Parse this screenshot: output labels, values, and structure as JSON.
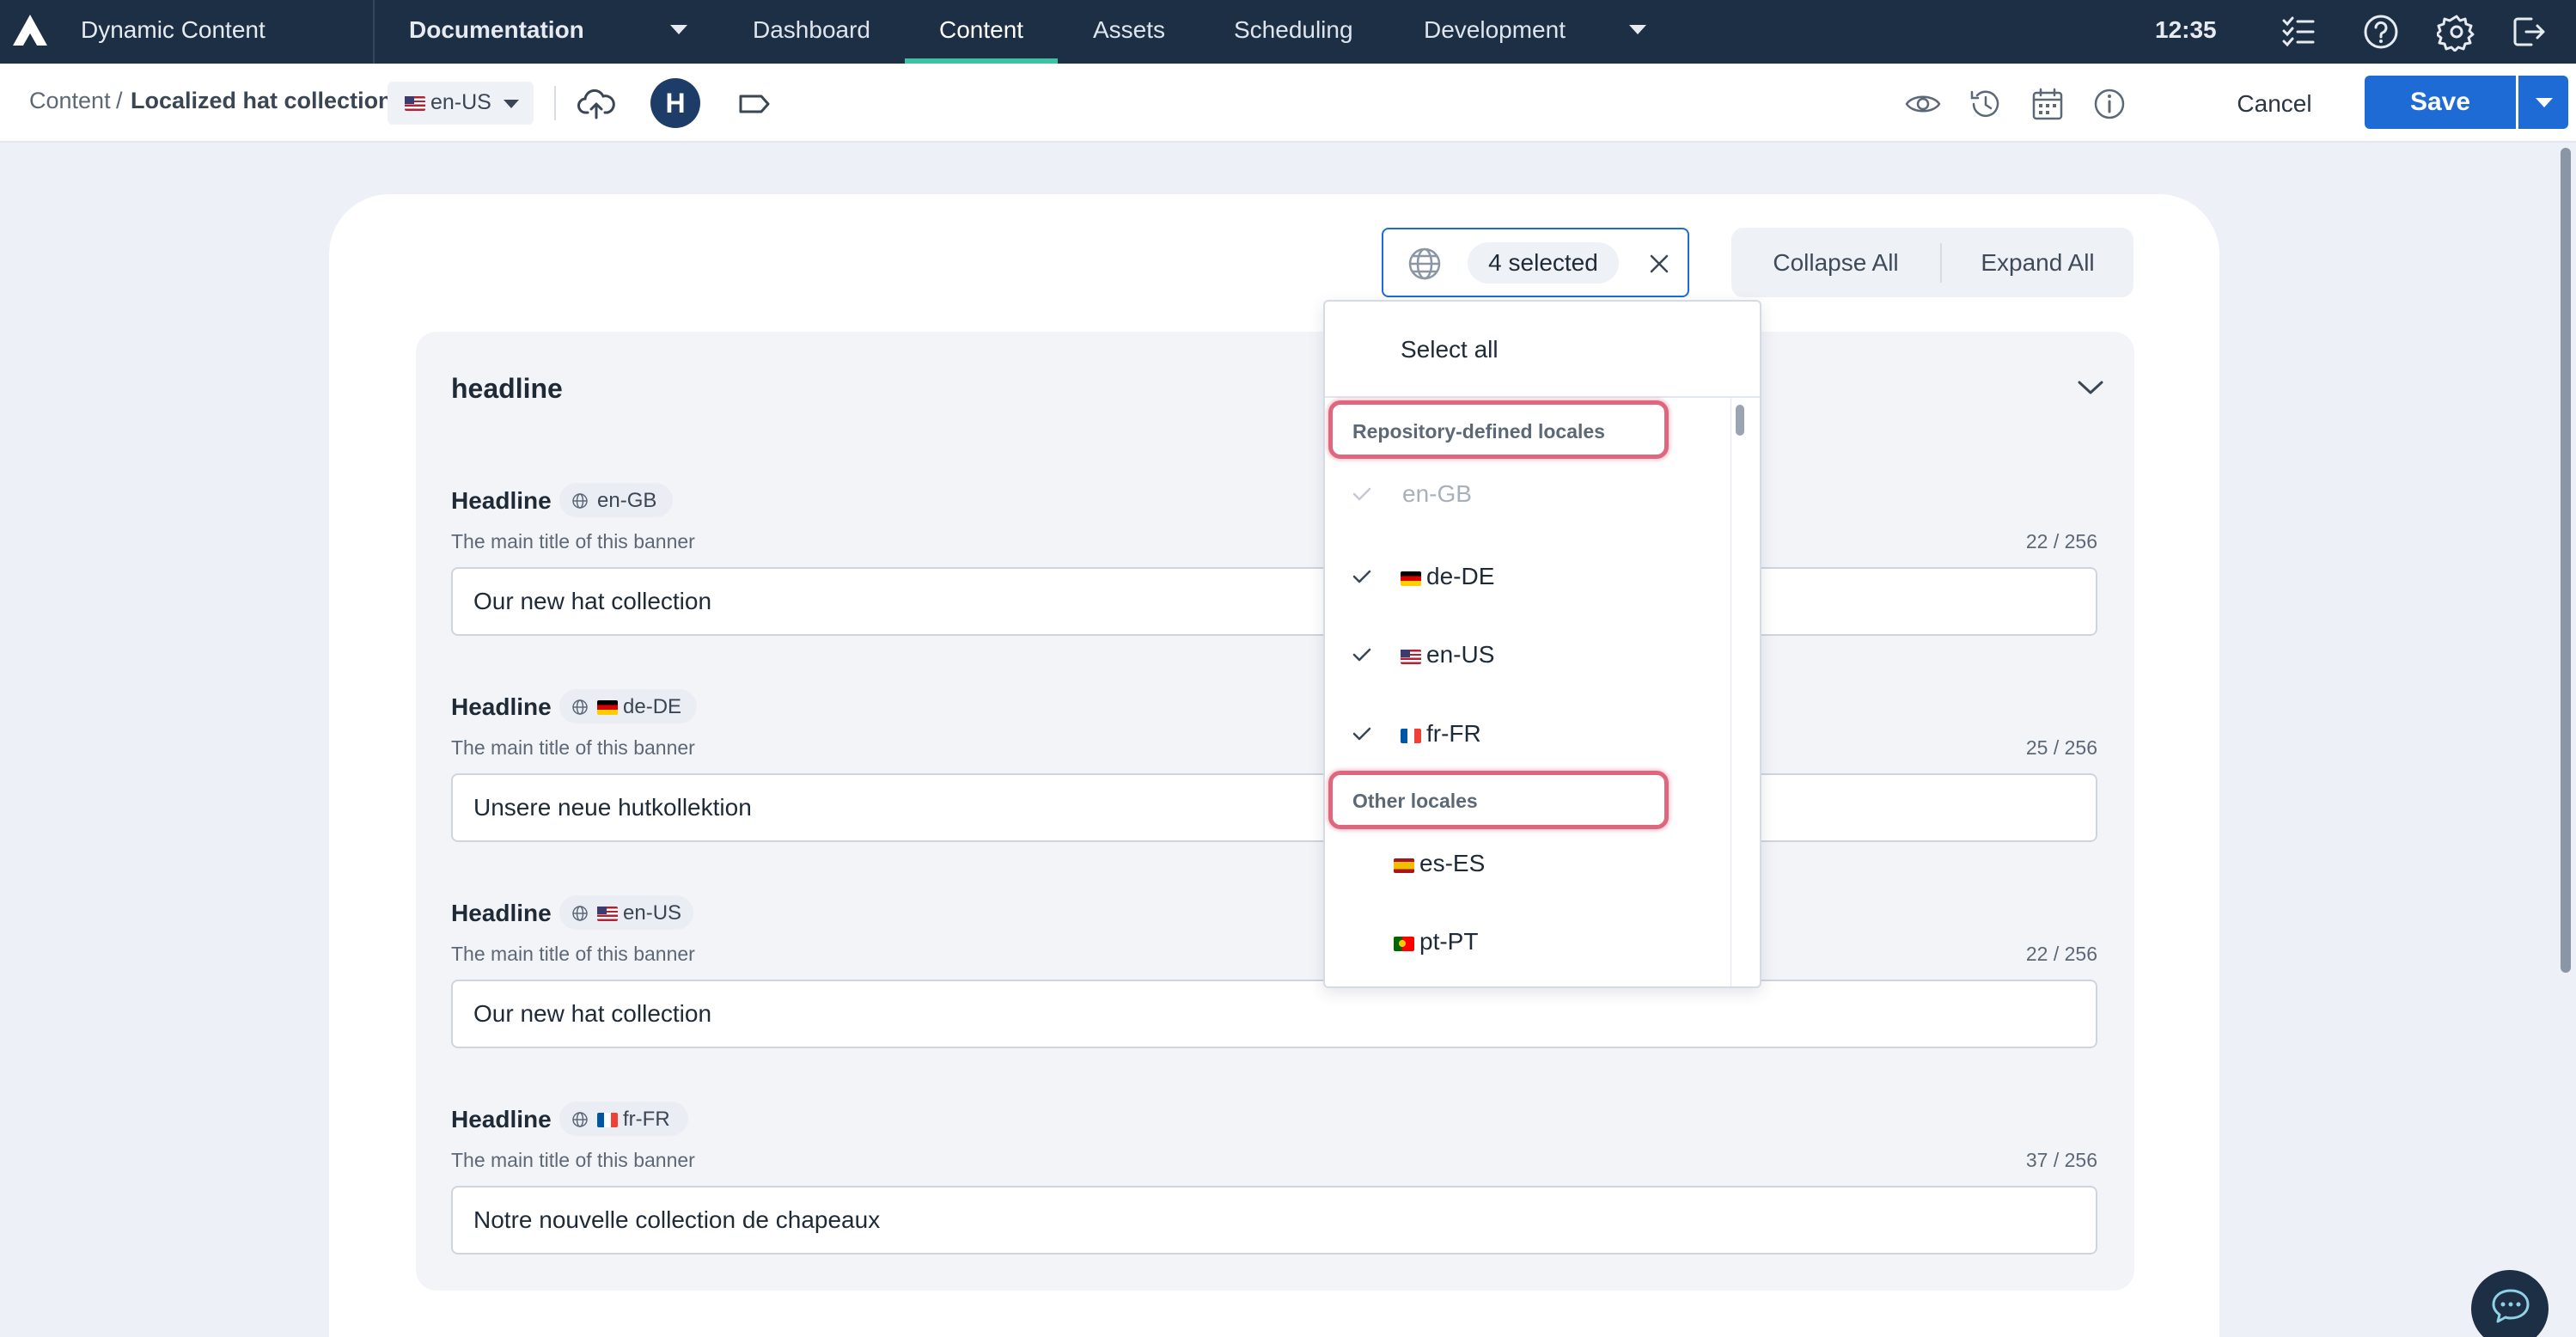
{
  "topbar": {
    "app_name": "Dynamic Content",
    "hub_name": "Documentation",
    "nav": [
      "Dashboard",
      "Content",
      "Assets",
      "Scheduling",
      "Development"
    ],
    "active_nav": "Content",
    "clock": "12:35"
  },
  "subbar": {
    "breadcrumb_root": "Content",
    "breadcrumb_sep": "/",
    "breadcrumb_current": "Localized hat collection",
    "locale": "en-US",
    "avatar_initial": "H",
    "cancel_label": "Cancel",
    "save_label": "Save"
  },
  "toolbar": {
    "filter_count": "4 selected",
    "collapse_all": "Collapse All",
    "expand_all": "Expand All"
  },
  "section": {
    "title": "headline",
    "fields": [
      {
        "label": "Headline",
        "locale": "en-GB",
        "flag": "none",
        "description": "The main title of this banner",
        "count": "22 / 256",
        "value": "Our new hat collection"
      },
      {
        "label": "Headline",
        "locale": "de-DE",
        "flag": "de",
        "description": "The main title of this banner",
        "count": "25 / 256",
        "value": "Unsere neue hutkollektion"
      },
      {
        "label": "Headline",
        "locale": "en-US",
        "flag": "us",
        "description": "The main title of this banner",
        "count": "22 / 256",
        "value": "Our new hat collection"
      },
      {
        "label": "Headline",
        "locale": "fr-FR",
        "flag": "fr",
        "description": "The main title of this banner",
        "count": "37 / 256",
        "value": "Notre nouvelle collection de chapeaux"
      }
    ]
  },
  "dropdown": {
    "select_all": "Select all",
    "group_repository": "Repository-defined locales",
    "group_other": "Other locales",
    "repository_items": [
      {
        "code": "en-GB",
        "flag": "none",
        "checked": true,
        "disabled": true
      },
      {
        "code": "de-DE",
        "flag": "de",
        "checked": true,
        "disabled": false
      },
      {
        "code": "en-US",
        "flag": "us",
        "checked": true,
        "disabled": false
      },
      {
        "code": "fr-FR",
        "flag": "fr",
        "checked": true,
        "disabled": false
      }
    ],
    "other_items": [
      {
        "code": "es-ES",
        "flag": "es",
        "checked": false
      },
      {
        "code": "pt-PT",
        "flag": "pt",
        "checked": false
      }
    ]
  },
  "colors": {
    "nav_bg": "#1d2f44",
    "nav_active_underline": "#3ec2a4",
    "primary_button": "#1e6bd6",
    "highlight_annotation": "#e0667e"
  },
  "icons": [
    "app-logo-icon",
    "checklist-icon",
    "help-icon",
    "settings-icon",
    "logout-icon",
    "upload-cloud-icon",
    "tag-icon",
    "preview-eye-icon",
    "history-icon",
    "calendar-icon",
    "info-icon",
    "globe-icon",
    "close-icon",
    "chevron-down-icon",
    "check-icon",
    "chat-icon"
  ]
}
